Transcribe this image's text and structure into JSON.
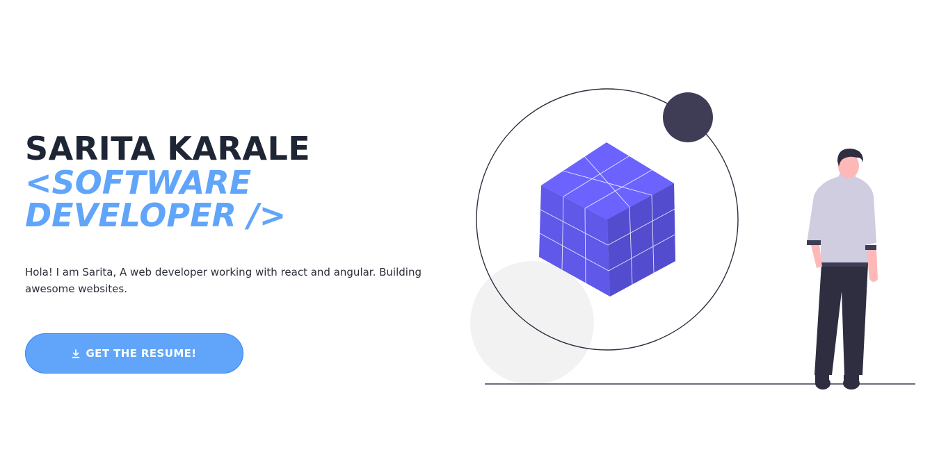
{
  "hero": {
    "name": "SARITA KARALE",
    "role": "<SOFTWARE DEVELOPER />",
    "intro": "Hola! I am Sarita, A web developer working with react and angular. Building awesome websites."
  },
  "cta": {
    "label": "GET THE RESUME!",
    "icon": "download-icon"
  },
  "illustration": {
    "description_icon": "developer-with-cube-illustration"
  },
  "colors": {
    "accent": "#60a5fa",
    "heading": "#1e2535",
    "cube": "#6c63ff",
    "dark": "#3f3d56"
  }
}
